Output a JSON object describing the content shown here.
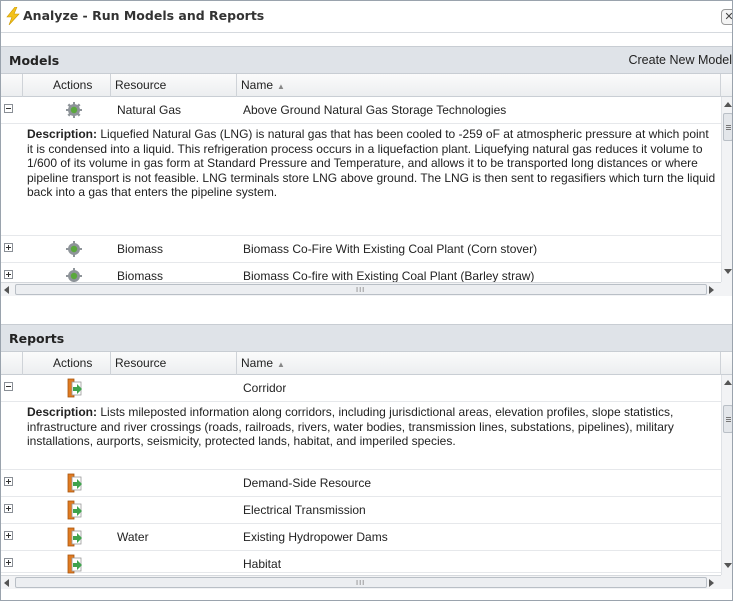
{
  "window": {
    "title": "Analyze - Run Models and Reports",
    "title_icon": "lightning-icon",
    "close_label": "✕"
  },
  "models": {
    "section_title": "Models",
    "create_link": "Create New Model",
    "columns": {
      "actions": "Actions",
      "resource": "Resource",
      "name": "Name"
    },
    "sort_indicator": "▲",
    "rows": [
      {
        "resource": "Natural Gas",
        "name": "Above Ground Natural Gas Storage Technologies",
        "expanded": true,
        "icon": "gear-icon"
      },
      {
        "resource": "Biomass",
        "name": "Biomass Co-Fire With Existing Coal Plant (Corn stover)",
        "expanded": false,
        "icon": "gear-icon"
      },
      {
        "resource": "Biomass",
        "name": "Biomass Co-fire with Existing Coal Plant (Barley straw)",
        "expanded": false,
        "icon": "gear-icon"
      }
    ],
    "description_label": "Description:",
    "description_text": " Liquefied Natural Gas (LNG) is natural gas that has been cooled to -259 oF at atmospheric pressure at which point it is condensed into a liquid. This refrigeration process occurs in a liquefaction plant. Liquefying natural gas reduces it volume to 1/600 of its volume in gas form at Standard Pressure and Temperature, and allows it to be transported long distances or where pipeline transport is not feasible. LNG terminals store LNG above ground. The LNG is then sent to regasifiers which turn the liquid back into a gas that enters the pipeline system.",
    "hscroll_grip": "III"
  },
  "reports": {
    "section_title": "Reports",
    "columns": {
      "actions": "Actions",
      "resource": "Resource",
      "name": "Name"
    },
    "sort_indicator": "▲",
    "rows": [
      {
        "resource": "",
        "name": "Corridor",
        "expanded": true,
        "icon": "report-icon"
      },
      {
        "resource": "",
        "name": "Demand-Side Resource",
        "expanded": false,
        "icon": "report-icon"
      },
      {
        "resource": "",
        "name": "Electrical Transmission",
        "expanded": false,
        "icon": "report-icon"
      },
      {
        "resource": "Water",
        "name": "Existing Hydropower Dams",
        "expanded": false,
        "icon": "report-icon"
      },
      {
        "resource": "",
        "name": "Habitat",
        "expanded": false,
        "icon": "report-icon"
      }
    ],
    "description_label": "Description:",
    "description_text": " Lists mileposted information along corridors, including jurisdictional areas, elevation profiles, slope statistics, infrastructure and river crossings (roads, railroads, rivers, water bodies, transmission lines, substations, pipelines), military installations, aurports, seismicity, protected lands, habitat, and imperiled species.",
    "hscroll_grip": "III"
  },
  "colors": {
    "section_header_bg": "#dfe3e8",
    "gear_green": "#5aa83c",
    "report_orange": "#e07b22",
    "report_arrow_green": "#3fa34d",
    "lightning_yellow": "#f4c21b"
  }
}
